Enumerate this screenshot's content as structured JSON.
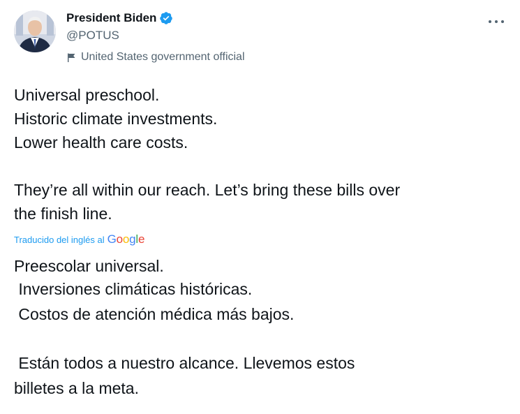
{
  "author": {
    "display_name": "President Biden",
    "handle": "@POTUS",
    "label": "United States government official",
    "avatar_icon": "portrait-avatar",
    "verified_icon": "verified-badge-icon",
    "label_icon": "flag-icon",
    "verified_color": "#1d9bf0"
  },
  "menu": {
    "icon": "more-options-icon"
  },
  "tweet": {
    "lines": [
      "Universal preschool.",
      "Historic climate investments.",
      "Lower health care costs.",
      "",
      "They’re all within our reach. Let’s bring these bills over",
      "the finish line."
    ]
  },
  "translation": {
    "attribution": "Traducido del inglés al",
    "provider_letters": [
      "G",
      "o",
      "o",
      "g",
      "l",
      "e"
    ],
    "provider_colors": [
      "#4285f4",
      "#ea4335",
      "#fbbc05",
      "#4285f4",
      "#34a853",
      "#ea4335"
    ],
    "lines": [
      "Preescolar universal.",
      " Inversiones climáticas históricas.",
      " Costos de atención médica más bajos.",
      "",
      " Están todos a nuestro alcance. Llevemos estos",
      "billetes a la meta."
    ]
  }
}
